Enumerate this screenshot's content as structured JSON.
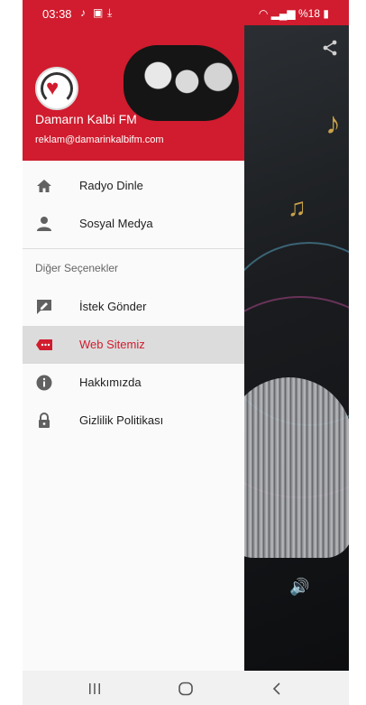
{
  "status_bar": {
    "time": "03:38",
    "battery": "%18"
  },
  "drawer": {
    "brand": "Damarın Kalbi FM",
    "email": "reklam@damarinkalbifm.com",
    "primary_items": [
      {
        "label": "Radyo Dinle",
        "icon": "home-icon"
      },
      {
        "label": "Sosyal Medya",
        "icon": "person-icon"
      }
    ],
    "section_title": "Diğer Seçenekler",
    "secondary_items": [
      {
        "label": "İstek Gönder",
        "icon": "edit-message-icon"
      },
      {
        "label": "Web Sitemiz",
        "icon": "web-label-icon",
        "active": true
      },
      {
        "label": "Hakkımızda",
        "icon": "info-icon"
      },
      {
        "label": "Gizlilik Politikası",
        "icon": "lock-icon"
      }
    ]
  },
  "colors": {
    "accent": "#d01c2e",
    "active_bg": "#dcdcdc",
    "icon": "#616161"
  }
}
